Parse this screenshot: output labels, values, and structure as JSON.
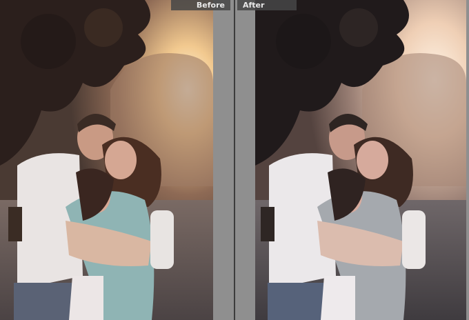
{
  "compare": {
    "before_label": "Before",
    "after_label": "After"
  },
  "colors": {
    "background": "#545454",
    "gutter": "#8f8f8f",
    "label_bg": "#464646",
    "label_text": "#e8e8e8"
  }
}
